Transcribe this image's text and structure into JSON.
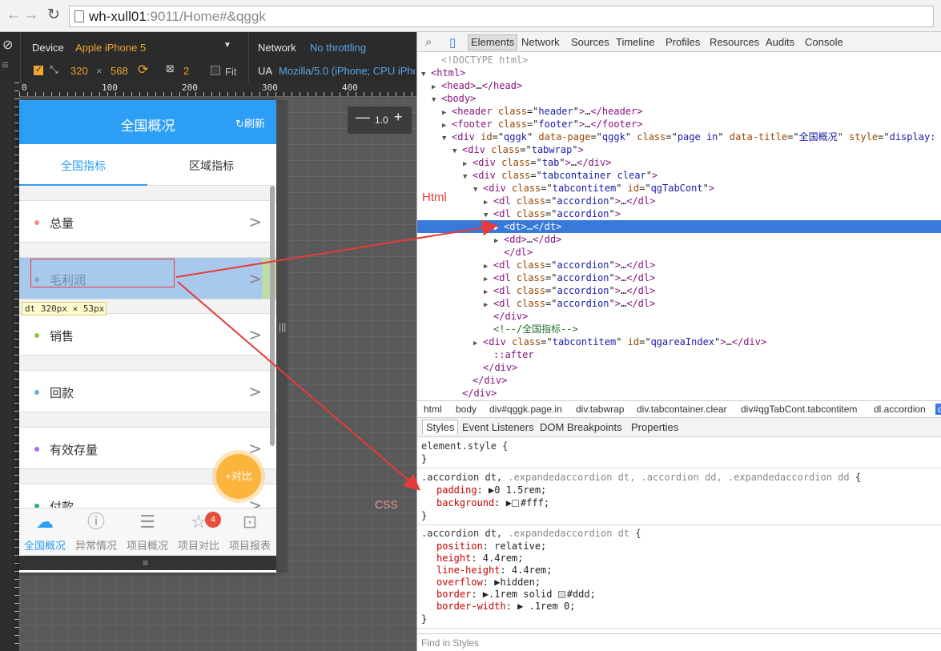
{
  "browser": {
    "url_host": "wh-xull01",
    "url_rest": ":9011/Home#&qggk"
  },
  "devicebar": {
    "device_label": "Device",
    "device_value": "Apple iPhone 5",
    "network_label": "Network",
    "network_value": "No throttling",
    "width": "320",
    "times": "×",
    "height": "568",
    "dpr": "2",
    "fit_label": "Fit",
    "ua_label": "UA",
    "ua_value": "Mozilla/5.0 (iPhone; CPU iPho"
  },
  "ruler": {
    "ticks": [
      "0",
      "100",
      "200",
      "300",
      "400"
    ]
  },
  "zoom": {
    "minus": "—",
    "value": "1.0",
    "plus": "+"
  },
  "phone": {
    "header_title": "全国概况",
    "refresh": "刷新",
    "tab1": "全国指标",
    "tab2": "区域指标",
    "items": [
      {
        "label": "总量",
        "color": "#ef8f83"
      },
      {
        "label": "毛利润",
        "color": "#8aa6c8"
      },
      {
        "label": "销售",
        "color": "#8fc84a"
      },
      {
        "label": "回款",
        "color": "#6ea6e8"
      },
      {
        "label": "有效存量",
        "color": "#b06ae0"
      },
      {
        "label": "付款",
        "color": "#2aa88a"
      }
    ],
    "fab": "+对比",
    "dim_tip": "dt 320px × 53px",
    "nav": [
      {
        "label": "全国概况",
        "icon": "china-map-icon"
      },
      {
        "label": "异常情况",
        "icon": "alert-icon"
      },
      {
        "label": "项目概况",
        "icon": "list-icon"
      },
      {
        "label": "项目对比",
        "icon": "star-icon",
        "badge": "4"
      },
      {
        "label": "项目报表",
        "icon": "chart-board-icon"
      }
    ],
    "handle": "≡"
  },
  "devtools": {
    "tabs": [
      "Elements",
      "Network",
      "Sources",
      "Timeline",
      "Profiles",
      "Resources",
      "Audits",
      "Console"
    ],
    "tree": [
      {
        "indent": 1,
        "tri": "",
        "html": "<span class='dc'>&lt;!DOCTYPE html&gt;</span>"
      },
      {
        "indent": 0,
        "tri": "▼",
        "html": "<span class='tg'>&lt;html&gt;</span>"
      },
      {
        "indent": 1,
        "tri": "▶",
        "html": "<span class='tg'>&lt;head&gt;</span>…<span class='tg'>&lt;/head&gt;</span>"
      },
      {
        "indent": 1,
        "tri": "▼",
        "html": "<span class='tg'>&lt;body&gt;</span>"
      },
      {
        "indent": 2,
        "tri": "▶",
        "html": "<span class='tg'>&lt;header</span> <span class='at'>class</span>=\"<span class='av'>header</span>\"<span class='tg'>&gt;</span>…<span class='tg'>&lt;/header&gt;</span>"
      },
      {
        "indent": 2,
        "tri": "▶",
        "html": "<span class='tg'>&lt;footer</span> <span class='at'>class</span>=\"<span class='av'>footer</span>\"<span class='tg'>&gt;</span>…<span class='tg'>&lt;/footer&gt;</span>"
      },
      {
        "indent": 2,
        "tri": "▼",
        "html": "<span class='tg'>&lt;div</span> <span class='at'>id</span>=\"<span class='av'>qggk</span>\" <span class='at'>data-page</span>=\"<span class='av'>qggk</span>\" <span class='at'>class</span>=\"<span class='av'>page in</span>\" <span class='at'>data-title</span>=\"<span class='av'>全国概况</span>\" <span class='at'>style</span>=\"<span class='av'>display:</span>"
      },
      {
        "indent": 3,
        "tri": "▼",
        "html": "<span class='tg'>&lt;div</span> <span class='at'>class</span>=\"<span class='av'>tabwrap</span>\"<span class='tg'>&gt;</span>"
      },
      {
        "indent": 4,
        "tri": "▶",
        "html": "<span class='tg'>&lt;div</span> <span class='at'>class</span>=\"<span class='av'>tab</span>\"<span class='tg'>&gt;</span>…<span class='tg'>&lt;/div&gt;</span>"
      },
      {
        "indent": 4,
        "tri": "▼",
        "html": "<span class='tg'>&lt;div</span> <span class='at'>class</span>=\"<span class='av'>tabcontainer clear</span>\"<span class='tg'>&gt;</span>"
      },
      {
        "indent": 5,
        "tri": "▼",
        "html": "<span class='tg'>&lt;div</span> <span class='at'>class</span>=\"<span class='av'>tabcontitem</span>\" <span class='at'>id</span>=\"<span class='av'>qgTabCont</span>\"<span class='tg'>&gt;</span>"
      },
      {
        "indent": 6,
        "tri": "▶",
        "html": "<span class='tg'>&lt;dl</span> <span class='at'>class</span>=\"<span class='av'>accordion</span>\"<span class='tg'>&gt;</span>…<span class='tg'>&lt;/dl&gt;</span>"
      },
      {
        "indent": 6,
        "tri": "▼",
        "html": "<span class='tg'>&lt;dl</span> <span class='at'>class</span>=\"<span class='av'>accordion</span>\"<span class='tg'>&gt;</span>"
      },
      {
        "indent": 7,
        "tri": "▶",
        "html": "<span class='tg'>&lt;dt&gt;</span>…<span class='tg'>&lt;/dt&gt;</span>",
        "selected": true
      },
      {
        "indent": 7,
        "tri": "▶",
        "html": "<span class='tg'>&lt;dd&gt;</span>…<span class='tg'>&lt;/dd&gt;</span>"
      },
      {
        "indent": 7,
        "tri": "",
        "html": "<span class='tg'>&lt;/dl&gt;</span>"
      },
      {
        "indent": 6,
        "tri": "▶",
        "html": "<span class='tg'>&lt;dl</span> <span class='at'>class</span>=\"<span class='av'>accordion</span>\"<span class='tg'>&gt;</span>…<span class='tg'>&lt;/dl&gt;</span>"
      },
      {
        "indent": 6,
        "tri": "▶",
        "html": "<span class='tg'>&lt;dl</span> <span class='at'>class</span>=\"<span class='av'>accordion</span>\"<span class='tg'>&gt;</span>…<span class='tg'>&lt;/dl&gt;</span>"
      },
      {
        "indent": 6,
        "tri": "▶",
        "html": "<span class='tg'>&lt;dl</span> <span class='at'>class</span>=\"<span class='av'>accordion</span>\"<span class='tg'>&gt;</span>…<span class='tg'>&lt;/dl&gt;</span>"
      },
      {
        "indent": 6,
        "tri": "▶",
        "html": "<span class='tg'>&lt;dl</span> <span class='at'>class</span>=\"<span class='av'>accordion</span>\"<span class='tg'>&gt;</span>…<span class='tg'>&lt;/dl&gt;</span>"
      },
      {
        "indent": 6,
        "tri": "",
        "html": "<span class='tg'>&lt;/div&gt;</span>"
      },
      {
        "indent": 6,
        "tri": "",
        "html": "<span class='cm'>&lt;!--/全国指标--&gt;</span>"
      },
      {
        "indent": 5,
        "tri": "▶",
        "html": "<span class='tg'>&lt;div</span> <span class='at'>class</span>=\"<span class='av'>tabcontitem</span>\" <span class='at'>id</span>=\"<span class='av'>qgareaIndex</span>\"<span class='tg'>&gt;</span>…<span class='tg'>&lt;/div&gt;</span>"
      },
      {
        "indent": 6,
        "tri": "",
        "html": "<span class='tg'>::after</span>"
      },
      {
        "indent": 5,
        "tri": "",
        "html": "<span class='tg'>&lt;/div&gt;</span>"
      },
      {
        "indent": 4,
        "tri": "",
        "html": "<span class='tg'>&lt;/div&gt;</span>"
      },
      {
        "indent": 3,
        "tri": "",
        "html": "<span class='tg'>&lt;/div&gt;</span>"
      }
    ],
    "crumbs": [
      "html",
      "body",
      "div#qggk.page.in",
      "div.tabwrap",
      "div.tabcontainer.clear",
      "div#qgTabCont.tabcontitem",
      "dl.accordion",
      "dt"
    ],
    "subtabs": [
      "Styles",
      "Event Listeners",
      "DOM Breakpoints",
      "Properties"
    ],
    "find_placeholder": "Find in Styles"
  },
  "annotations": {
    "html_label": "Html",
    "css_label": "CSS"
  }
}
